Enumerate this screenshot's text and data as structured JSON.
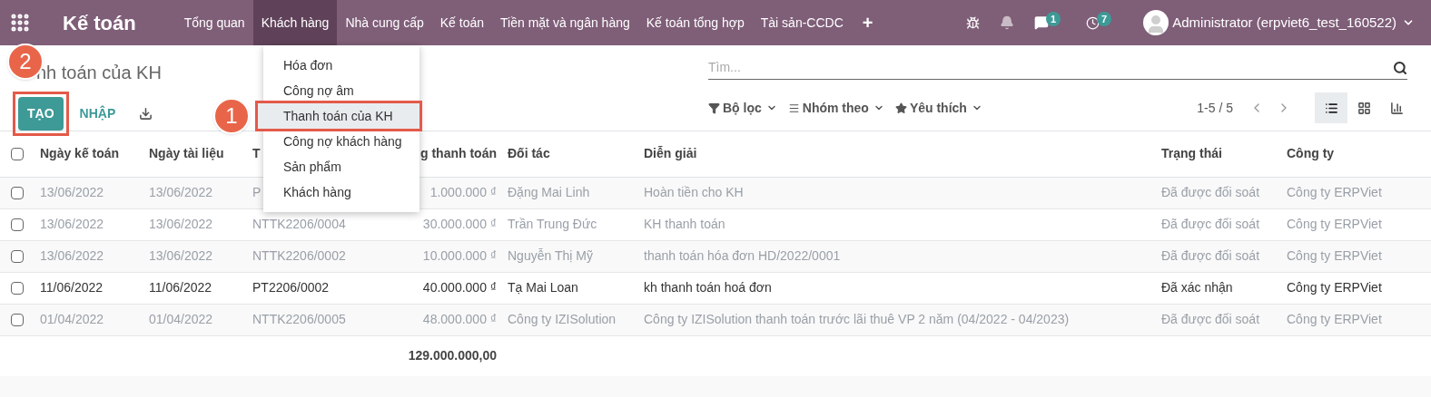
{
  "app_name": "Kế toán",
  "nav": [
    {
      "label": "Tổng quan",
      "selected": false
    },
    {
      "label": "Khách hàng",
      "selected": true
    },
    {
      "label": "Nhà cung cấp",
      "selected": false
    },
    {
      "label": "Kế toán",
      "selected": false
    },
    {
      "label": "Tiền mặt và ngân hàng",
      "selected": false
    },
    {
      "label": "Kế toán tổng hợp",
      "selected": false
    },
    {
      "label": "Tài sản-CCDC",
      "selected": false
    },
    {
      "label": "+",
      "selected": false
    }
  ],
  "systray": {
    "messages_count": "1",
    "activities_count": "7",
    "user": "Administrator (erpviet6_test_160522)"
  },
  "dropdown": [
    {
      "label": "Hóa đơn",
      "selected": false,
      "framed": false
    },
    {
      "label": "Công nợ âm",
      "selected": false,
      "framed": false
    },
    {
      "label": "Thanh toán của KH",
      "selected": true,
      "framed": true,
      "callout": "1"
    },
    {
      "label": "Công nợ khách hàng",
      "selected": false,
      "framed": false
    },
    {
      "label": "Sản phẩm",
      "selected": false,
      "framed": false
    },
    {
      "label": "Khách hàng",
      "selected": false,
      "framed": false
    }
  ],
  "page_title": "nh toán của KH",
  "create_button": {
    "label": "TẠO",
    "framed": true,
    "callout": "2"
  },
  "import_button": {
    "label": "NHẬP"
  },
  "search": {
    "placeholder": "Tìm..."
  },
  "filters": [
    {
      "kind": "filter",
      "label": "Bộ lọc"
    },
    {
      "kind": "group",
      "label": "Nhóm theo"
    },
    {
      "kind": "favorite",
      "label": "Yêu thích"
    }
  ],
  "pager": "1-5 / 5",
  "views": [
    {
      "kind": "list",
      "selected": true
    },
    {
      "kind": "kanban",
      "selected": false
    },
    {
      "kind": "graph",
      "selected": false
    }
  ],
  "table": {
    "select_all": {
      "checked": false
    },
    "columns": [
      "Ngày kế toán",
      "Ngày tài liệu",
      "T",
      "g thanh toán",
      "Đối tác",
      "Diễn giải",
      "Trạng thái",
      "Công ty"
    ],
    "rows": [
      {
        "checked": false,
        "reconciled": true,
        "cells": [
          "13/06/2022",
          "13/06/2022",
          "P",
          "1.000.000 ₫",
          "Đặng Mai Linh",
          "Hoàn tiền cho KH",
          "Đã được đối soát",
          "Công ty ERPViet"
        ]
      },
      {
        "checked": false,
        "reconciled": true,
        "cells": [
          "13/06/2022",
          "13/06/2022",
          "NTTK2206/0004",
          "30.000.000 ₫",
          "Trần Trung Đức",
          "KH thanh toán",
          "Đã được đối soát",
          "Công ty ERPViet"
        ]
      },
      {
        "checked": false,
        "reconciled": true,
        "cells": [
          "13/06/2022",
          "13/06/2022",
          "NTTK2206/0002",
          "10.000.000 ₫",
          "Nguyễn Thị Mỹ",
          "thanh toán hóa đơn HD/2022/0001",
          "Đã được đối soát",
          "Công ty ERPViet"
        ]
      },
      {
        "checked": false,
        "reconciled": false,
        "cells": [
          "11/06/2022",
          "11/06/2022",
          "PT2206/0002",
          "40.000.000 ₫",
          "Tạ Mai Loan",
          "kh thanh toán hoá đơn",
          "Đã xác nhận",
          "Công ty ERPViet"
        ]
      },
      {
        "checked": false,
        "reconciled": true,
        "cells": [
          "01/04/2022",
          "01/04/2022",
          "NTTK2206/0005",
          "48.000.000 ₫",
          "Công ty IZISolution",
          "Công ty IZISolution thanh toán trước lãi thuê VP 2 năm (04/2022 - 04/2023)",
          "Đã được đối soát",
          "Công ty ERPViet"
        ]
      }
    ],
    "total": "129.000.000,00"
  }
}
